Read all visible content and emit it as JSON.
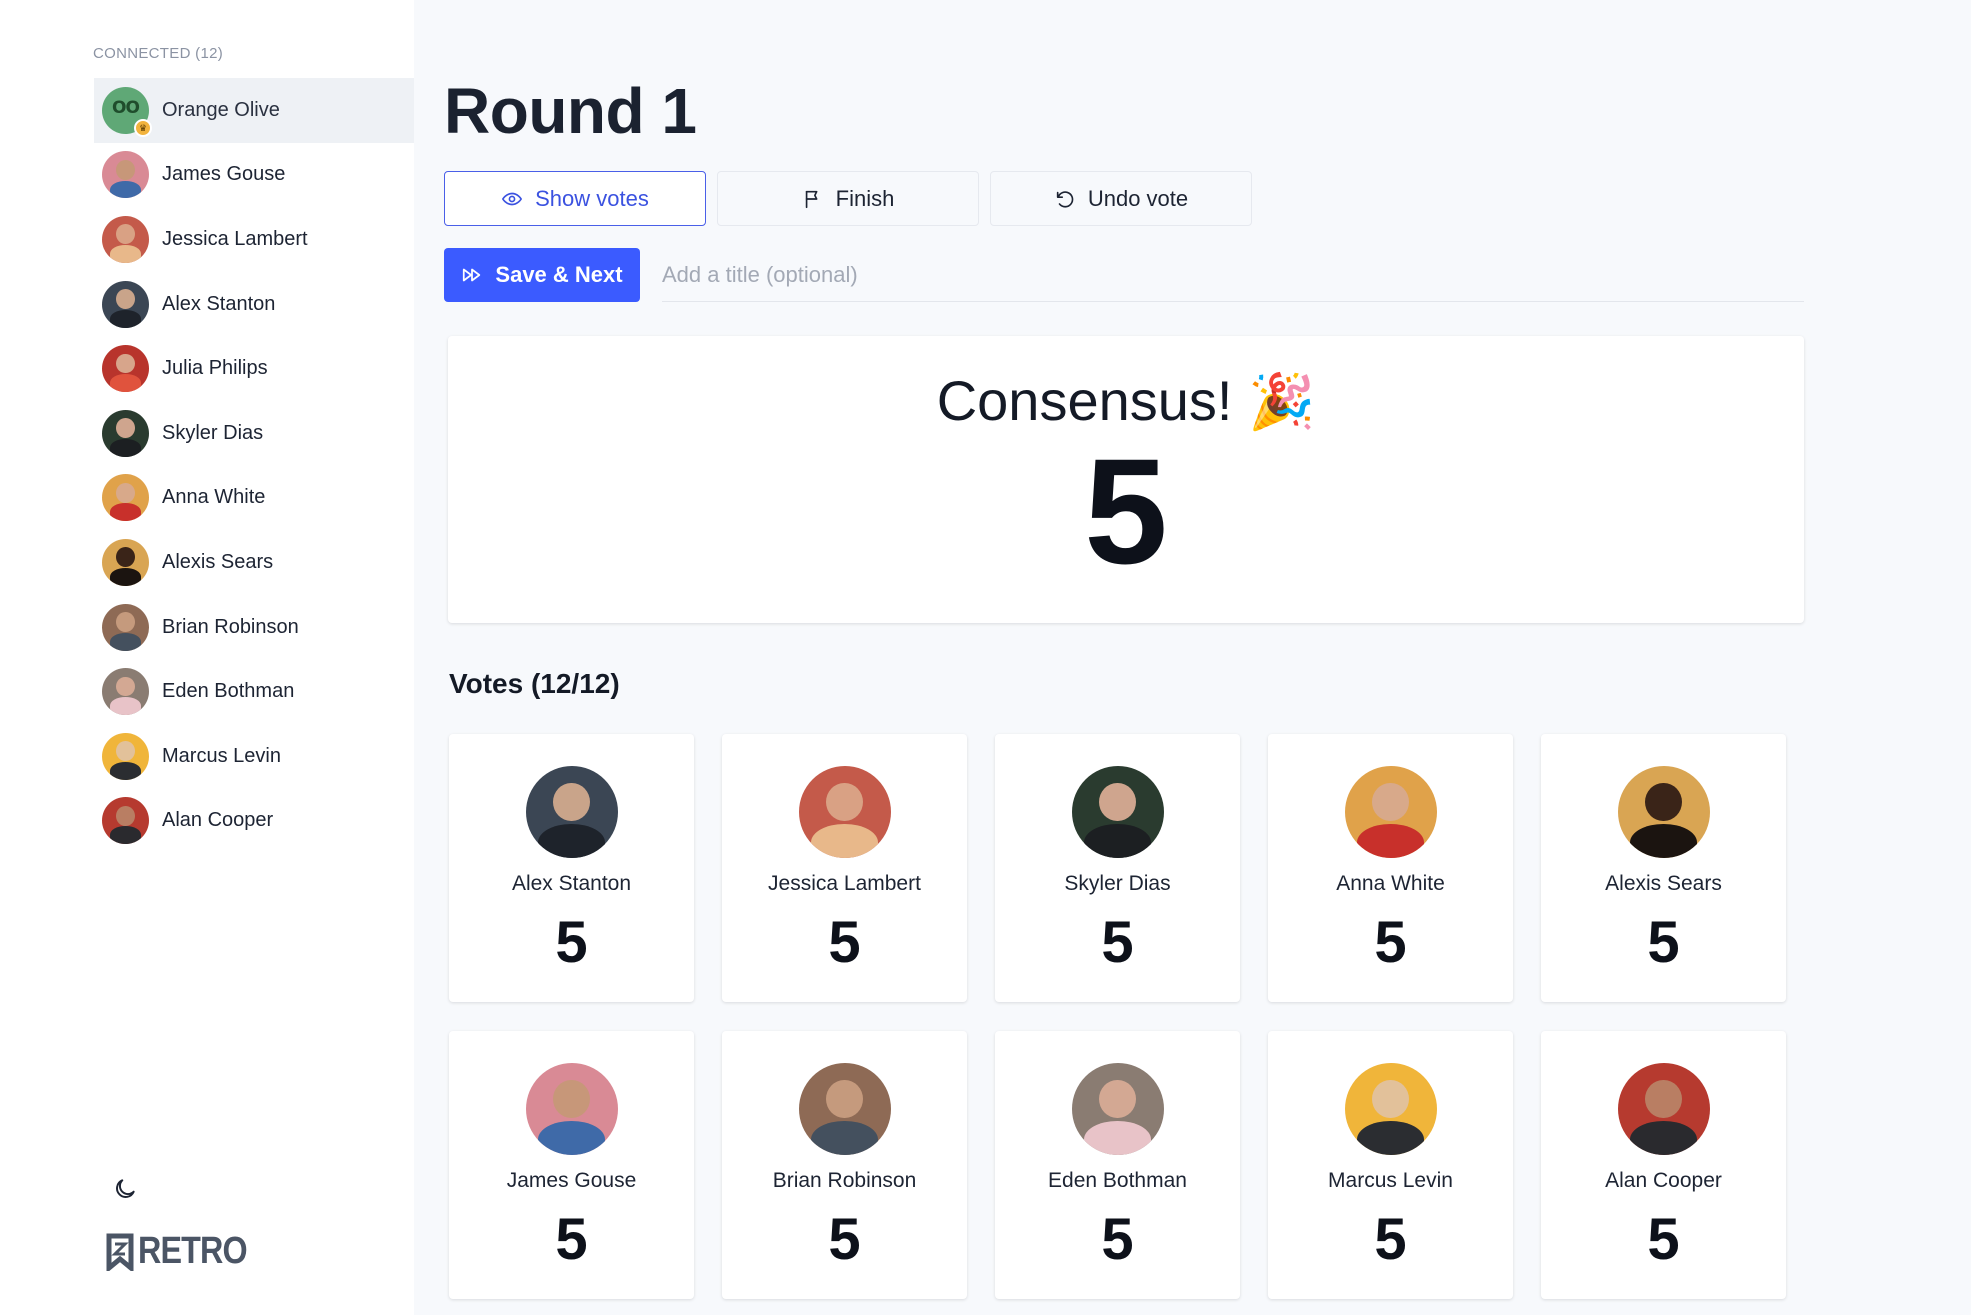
{
  "sidebar": {
    "heading": "CONNECTED (12)",
    "items": [
      {
        "name": "Orange Olive",
        "bg": "#5fa876",
        "face": "#5fa876",
        "body": "#5fa876",
        "active": true
      },
      {
        "name": "James Gouse",
        "bg": "#d98a95",
        "face": "#c79779",
        "body": "#3f6aa8"
      },
      {
        "name": "Jessica Lambert",
        "bg": "#c45a4a",
        "face": "#d9a184",
        "body": "#e8b88a"
      },
      {
        "name": "Alex Stanton",
        "bg": "#3b4654",
        "face": "#c9a48a",
        "body": "#1e232b"
      },
      {
        "name": "Julia Philips",
        "bg": "#b8342c",
        "face": "#d7a58b",
        "body": "#e0533d"
      },
      {
        "name": "Skyler Dias",
        "bg": "#2a3b2f",
        "face": "#cfa58e",
        "body": "#1c1f22"
      },
      {
        "name": "Anna White",
        "bg": "#e0a24a",
        "face": "#d8a98a",
        "body": "#c8302b"
      },
      {
        "name": "Alexis Sears",
        "bg": "#d9a553",
        "face": "#3a2418",
        "body": "#1b1410"
      },
      {
        "name": "Brian Robinson",
        "bg": "#8e6a55",
        "face": "#c59a7d",
        "body": "#44505e"
      },
      {
        "name": "Eden Bothman",
        "bg": "#8a7c72",
        "face": "#d3a893",
        "body": "#e8c3c8"
      },
      {
        "name": "Marcus Levin",
        "bg": "#f0b53a",
        "face": "#e2c19a",
        "body": "#2b2d31"
      },
      {
        "name": "Alan Cooper",
        "bg": "#b63a2f",
        "face": "#b97e63",
        "body": "#2a2a2e"
      }
    ]
  },
  "logo": {
    "text": "RETRO"
  },
  "main": {
    "title": "Round 1",
    "buttons": {
      "show_votes": "Show votes",
      "finish": "Finish",
      "undo_vote": "Undo vote",
      "save_next": "Save & Next"
    },
    "title_input_placeholder": "Add a title (optional)",
    "result": {
      "label": "Consensus!",
      "emoji": "🎉",
      "value": "5"
    },
    "votes_heading": "Votes (12/12)",
    "votes": [
      {
        "name": "Alex Stanton",
        "value": "5",
        "bg": "#3b4654",
        "face": "#c9a48a",
        "body": "#1e232b"
      },
      {
        "name": "Jessica Lambert",
        "value": "5",
        "bg": "#c45a4a",
        "face": "#d9a184",
        "body": "#e8b88a"
      },
      {
        "name": "Skyler Dias",
        "value": "5",
        "bg": "#2a3b2f",
        "face": "#cfa58e",
        "body": "#1c1f22"
      },
      {
        "name": "Anna White",
        "value": "5",
        "bg": "#e0a24a",
        "face": "#d8a98a",
        "body": "#c8302b"
      },
      {
        "name": "Alexis Sears",
        "value": "5",
        "bg": "#d9a553",
        "face": "#3a2418",
        "body": "#1b1410"
      },
      {
        "name": "James Gouse",
        "value": "5",
        "bg": "#d98a95",
        "face": "#c79779",
        "body": "#3f6aa8"
      },
      {
        "name": "Brian Robinson",
        "value": "5",
        "bg": "#8e6a55",
        "face": "#c59a7d",
        "body": "#44505e"
      },
      {
        "name": "Eden Bothman",
        "value": "5",
        "bg": "#8a7c72",
        "face": "#d3a893",
        "body": "#e8c3c8"
      },
      {
        "name": "Marcus Levin",
        "value": "5",
        "bg": "#f0b53a",
        "face": "#e2c19a",
        "body": "#2b2d31"
      },
      {
        "name": "Alan Cooper",
        "value": "5",
        "bg": "#b63a2f",
        "face": "#b97e63",
        "body": "#2a2a2e"
      }
    ]
  },
  "colors": {
    "accent": "#3b5bff",
    "accent_outline": "#4a5fe8"
  }
}
